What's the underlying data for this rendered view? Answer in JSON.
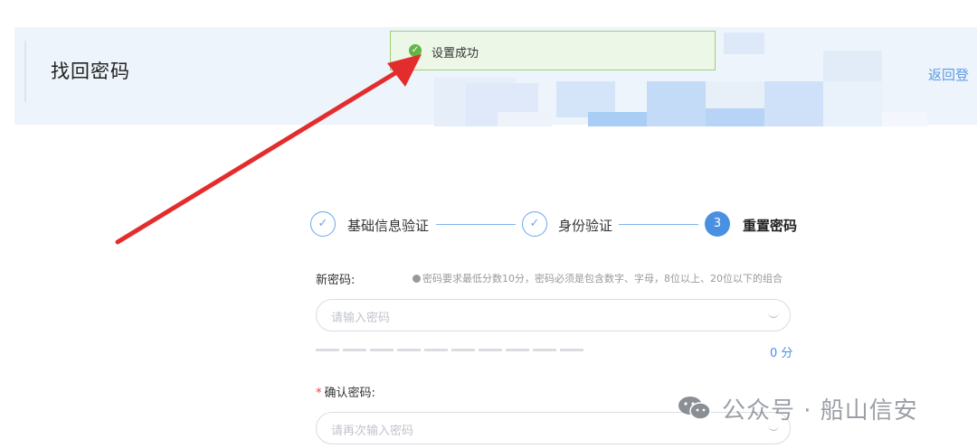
{
  "header": {
    "title": "找回密码",
    "back_link": "返回登"
  },
  "toast": {
    "text": "设置成功",
    "icon": "check-circle-icon",
    "color": "#62b744"
  },
  "steps": [
    {
      "label": "基础信息验证",
      "state": "done",
      "marker": "✓"
    },
    {
      "label": "身份验证",
      "state": "done",
      "marker": "✓"
    },
    {
      "label": "重置密码",
      "state": "active",
      "marker": "3"
    }
  ],
  "form": {
    "new_password": {
      "label": "新密码:",
      "hint": "密码要求最低分数10分，密码必须是包含数字、字母，8位以上、20位以下的组合",
      "placeholder": "请输入密码",
      "strength_segments": 10,
      "score_text": "0 分"
    },
    "confirm_password": {
      "required_mark": "*",
      "label": "确认密码:",
      "placeholder": "请再次输入密码"
    }
  },
  "watermark": {
    "text": "公众号 · 船山信安"
  },
  "colors": {
    "accent": "#4a90e2",
    "annotation_arrow": "#e32d2d",
    "success": "#62b744"
  }
}
